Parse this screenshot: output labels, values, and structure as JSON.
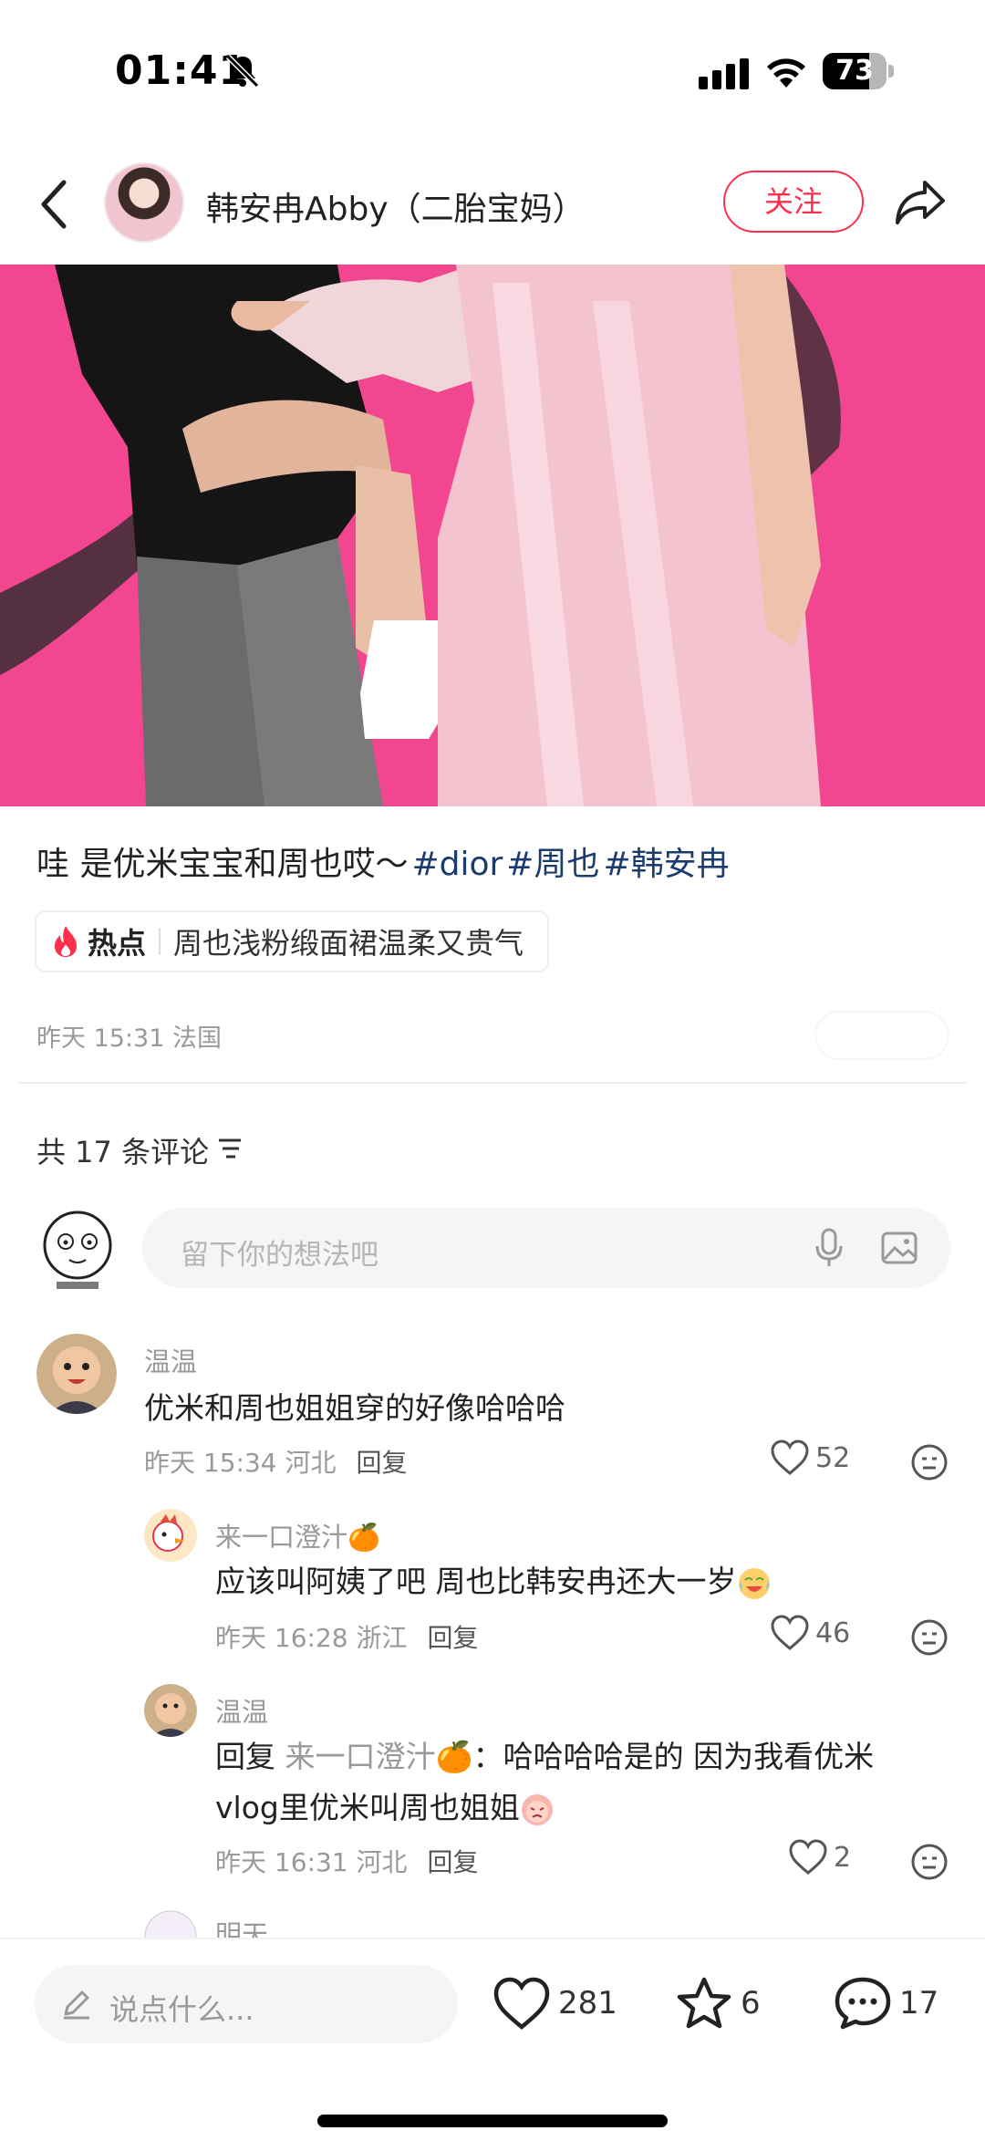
{
  "status_bar": {
    "time": "01:41",
    "battery": "73",
    "battery_fraction": 0.73,
    "icons": [
      "bell-slash-icon",
      "signal-icon",
      "wifi-icon",
      "battery-icon"
    ]
  },
  "header": {
    "author_name": "韩安冉Abby（二胎宝妈）",
    "follow_label": "关注",
    "icons": [
      "back-arrow-icon",
      "share-icon"
    ]
  },
  "post": {
    "caption_text": "哇 是优米宝宝和周也哎～",
    "hashtags": [
      "#dior",
      "#周也",
      "#韩安冉"
    ],
    "hot_label": "热点",
    "hot_text": "周也浅粉缎面裙温柔又贵气",
    "meta": "昨天 15:31 法国"
  },
  "comments_section": {
    "count_label": "共 17 条评论",
    "input_placeholder": "留下你的想法吧",
    "comments": [
      {
        "name": "温温",
        "text": "优米和周也姐姐穿的好像哈哈哈",
        "meta": "昨天 15:34 河北",
        "reply_label": "回复",
        "likes": "52"
      },
      {
        "name": "来一口澄汁🍊",
        "text": "应该叫阿姨了吧 周也比韩安冉还大一岁",
        "meta": "昨天 16:28 浙江",
        "reply_label": "回复",
        "likes": "46"
      },
      {
        "name": "温温",
        "reply_prefix": "回复",
        "reply_to": "来一口澄汁🍊",
        "text": "：哈哈哈哈是的 因为我看优米vlog里优米叫周也姐姐",
        "meta": "昨天 16:31 河北",
        "reply_label": "回复",
        "likes": "2"
      },
      {
        "name": "明天"
      }
    ]
  },
  "bottom_bar": {
    "say_placeholder": "说点什么...",
    "likes": "281",
    "favorites": "6",
    "comments": "17"
  },
  "colors": {
    "accent": "#ff2e4d",
    "hashtag": "#1b3c70",
    "image_background": "#f0418d"
  }
}
